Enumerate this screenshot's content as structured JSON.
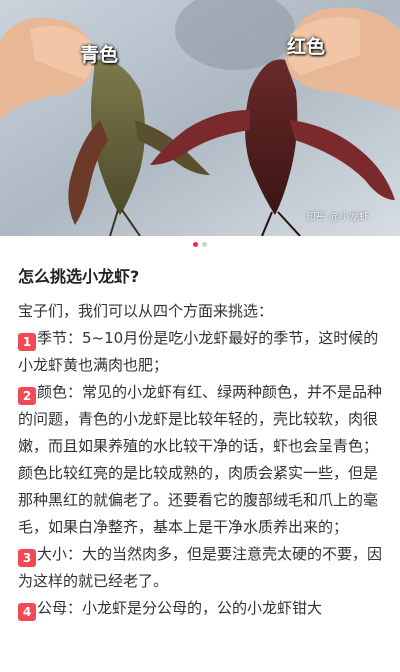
{
  "photo": {
    "label_left": "青色",
    "label_right": "红色",
    "watermark": "知乎 @小龙虾"
  },
  "carousel": {
    "current": 1,
    "total": 2
  },
  "post": {
    "title": "怎么挑选小龙虾?",
    "intro": "宝子们，我们可以从四个方面来挑选：",
    "items": [
      {
        "num": "1",
        "text": "季节：5~10月份是吃小龙虾最好的季节，这时候的小龙虾黄也满肉也肥；"
      },
      {
        "num": "2",
        "text": "颜色：常见的小龙虾有红、绿两种颜色，并不是品种的问题，青色的小龙虾是比较年轻的，壳比较软，肉很嫩，而且如果养殖的水比较干净的话，虾也会呈青色；颜色比较红亮的是比较成熟的，肉质会紧实一些，但是那种黑红的就偏老了。还要看它的腹部绒毛和爪上的毫毛，如果白净整齐，基本上是干净水质养出来的；"
      },
      {
        "num": "3",
        "text": "大小：大的当然肉多，但是要注意壳太硬的不要，因为这样的就已经老了。"
      },
      {
        "num": "4",
        "text": "公母：小龙虾是分公母的，公的小龙虾钳大"
      }
    ]
  },
  "colors": {
    "accent": "#ff2442",
    "number_badge": "#f04a57"
  }
}
